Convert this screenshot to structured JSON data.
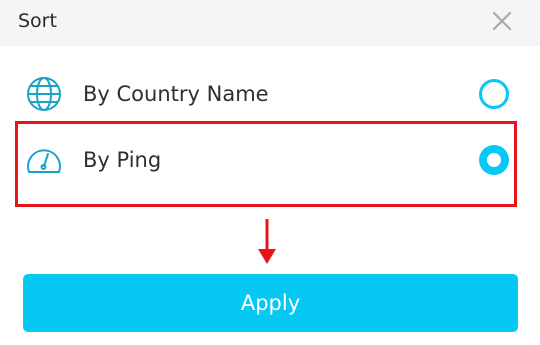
{
  "dialog": {
    "title": "Sort"
  },
  "options": [
    {
      "label": "By Country Name",
      "icon": "globe-icon",
      "selected": false
    },
    {
      "label": "By Ping",
      "icon": "speedometer-icon",
      "selected": true
    }
  ],
  "apply_label": "Apply",
  "colors": {
    "accent": "#06c8f2",
    "annotation": "#e8141b",
    "header_bg": "#f4f5f7"
  }
}
